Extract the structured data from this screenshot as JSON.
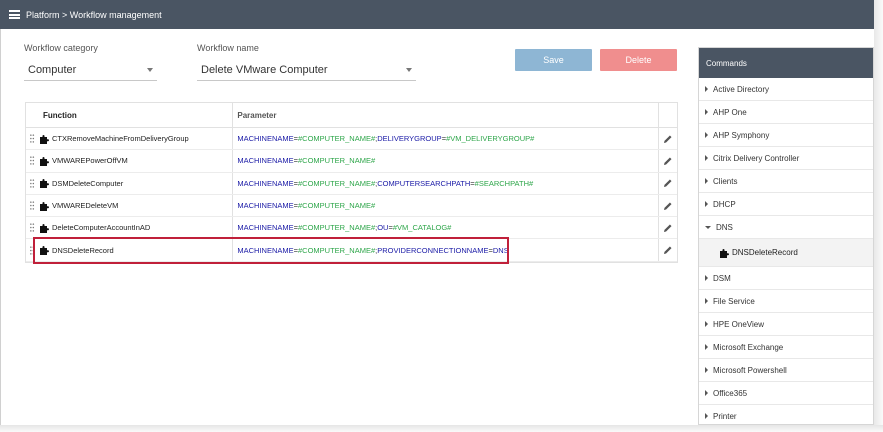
{
  "header": {
    "breadcrumb": "Platform > Workflow management"
  },
  "form": {
    "category_label": "Workflow category",
    "category_value": "Computer",
    "name_label": "Workflow name",
    "name_value": "Delete VMware Computer",
    "save_label": "Save",
    "delete_label": "Delete"
  },
  "grid": {
    "col_function": "Function",
    "col_parameter": "Parameter",
    "rows": [
      {
        "function": "CTXRemoveMachineFromDeliveryGroup",
        "parameter": [
          [
            "k",
            "MACHINENAME"
          ],
          [
            "o",
            "="
          ],
          [
            "v",
            "#COMPUTER_NAME#"
          ],
          [
            "o",
            ";"
          ],
          [
            "k",
            "DELIVERYGROUP"
          ],
          [
            "o",
            "="
          ],
          [
            "v",
            "#VM_DELIVERYGROUP#"
          ]
        ]
      },
      {
        "function": "VMWAREPowerOffVM",
        "parameter": [
          [
            "k",
            "MACHINENAME"
          ],
          [
            "o",
            "="
          ],
          [
            "v",
            "#COMPUTER_NAME#"
          ]
        ]
      },
      {
        "function": "DSMDeleteComputer",
        "parameter": [
          [
            "k",
            "MACHINENAME"
          ],
          [
            "o",
            "="
          ],
          [
            "v",
            "#COMPUTER_NAME#"
          ],
          [
            "o",
            ";"
          ],
          [
            "k",
            "COMPUTERSEARCHPATH"
          ],
          [
            "o",
            "="
          ],
          [
            "v",
            "#SEARCHPATH#"
          ]
        ]
      },
      {
        "function": "VMWAREDeleteVM",
        "parameter": [
          [
            "k",
            "MACHINENAME"
          ],
          [
            "o",
            "="
          ],
          [
            "v",
            "#COMPUTER_NAME#"
          ]
        ]
      },
      {
        "function": "DeleteComputerAccountInAD",
        "parameter": [
          [
            "k",
            "MACHINENAME"
          ],
          [
            "o",
            "="
          ],
          [
            "v",
            "#COMPUTER_NAME#"
          ],
          [
            "o",
            ";"
          ],
          [
            "k",
            "OU"
          ],
          [
            "o",
            "="
          ],
          [
            "v",
            "#VM_CATALOG#"
          ]
        ]
      },
      {
        "function": "DNSDeleteRecord",
        "parameter": [
          [
            "k",
            "MACHINENAME"
          ],
          [
            "o",
            "="
          ],
          [
            "v",
            "#COMPUTER_NAME#"
          ],
          [
            "o",
            ";"
          ],
          [
            "k",
            "PROVIDERCONNECTIONNAME"
          ],
          [
            "o",
            "="
          ],
          [
            "k",
            "DNS"
          ]
        ]
      }
    ]
  },
  "commands": {
    "title": "Commands",
    "items": [
      {
        "label": "Active Directory",
        "expanded": false
      },
      {
        "label": "AHP One",
        "expanded": false
      },
      {
        "label": "AHP Symphony",
        "expanded": false
      },
      {
        "label": "Citrix Delivery Controller",
        "expanded": false
      },
      {
        "label": "Clients",
        "expanded": false
      },
      {
        "label": "DHCP",
        "expanded": false
      },
      {
        "label": "DNS",
        "expanded": true,
        "children": [
          "DNSDeleteRecord"
        ]
      },
      {
        "label": "DSM",
        "expanded": false
      },
      {
        "label": "File Service",
        "expanded": false
      },
      {
        "label": "HPE OneView",
        "expanded": false
      },
      {
        "label": "Microsoft Exchange",
        "expanded": false
      },
      {
        "label": "Microsoft Powershell",
        "expanded": false
      },
      {
        "label": "Office365",
        "expanded": false
      },
      {
        "label": "Printer",
        "expanded": false
      }
    ]
  },
  "colors": {
    "topbar": "#4a5563",
    "save": "#8eb6d4",
    "delete": "#f08e8e",
    "highlight": "#c0203a",
    "param_key": "#1a1aa6",
    "param_var": "#2ea64a"
  },
  "icons": {
    "menu": "hamburger-icon",
    "function": "puzzle-icon",
    "drag": "drag-handle-icon",
    "edit": "pencil-icon",
    "expand": "chevron-right-icon",
    "collapse": "chevron-down-icon"
  }
}
